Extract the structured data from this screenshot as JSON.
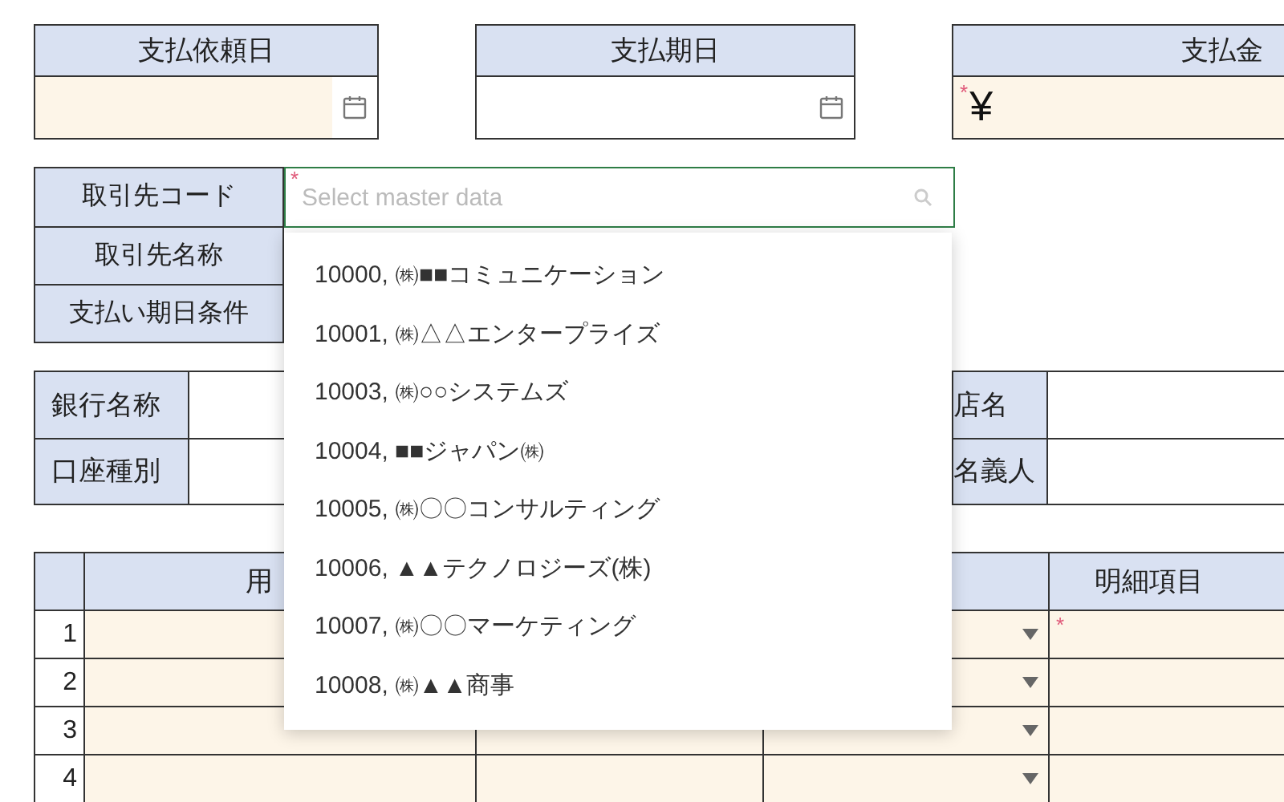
{
  "top_fields": [
    {
      "kind": "date",
      "label": "支払依頼日",
      "tinted": true
    },
    {
      "kind": "date",
      "label": "支払期日",
      "tinted": false
    },
    {
      "kind": "amount",
      "label": "支払金",
      "tinted": true,
      "required_mark": "*",
      "value": "¥"
    }
  ],
  "vendor": {
    "labels": [
      "取引先コード",
      "取引先名称",
      "支払い期日条件"
    ],
    "field": {
      "placeholder": "Select master data",
      "required_mark": "*",
      "focused": true
    }
  },
  "bank": {
    "rows": [
      {
        "label": "銀行名称",
        "label_2": "店名"
      },
      {
        "label": "口座種別",
        "label_2": "名義人"
      }
    ]
  },
  "detail_table": {
    "columns": [
      {
        "kind": "number"
      },
      {
        "kind": "text",
        "label": "用"
      },
      {
        "kind": "text"
      },
      {
        "kind": "select"
      },
      {
        "kind": "text",
        "label": "明細項目"
      }
    ],
    "rows": [
      {
        "number": "1",
        "required_mark": "*"
      },
      {
        "number": "2"
      },
      {
        "number": "3"
      },
      {
        "number": "4"
      }
    ]
  },
  "dropdown": {
    "options": [
      {
        "label": "10000, ㈱■■コミュニケーション"
      },
      {
        "label": "10001, ㈱△△エンタープライズ"
      },
      {
        "label": "10003, ㈱○○システムズ"
      },
      {
        "label": "10004, ■■ジャパン㈱"
      },
      {
        "label": "10005, ㈱〇〇コンサルティング"
      },
      {
        "label": "10006, ▲▲テクノロジーズ(株)"
      },
      {
        "label": "10007, ㈱〇〇マーケティング"
      },
      {
        "label": "10008, ㈱▲▲商事"
      }
    ]
  }
}
